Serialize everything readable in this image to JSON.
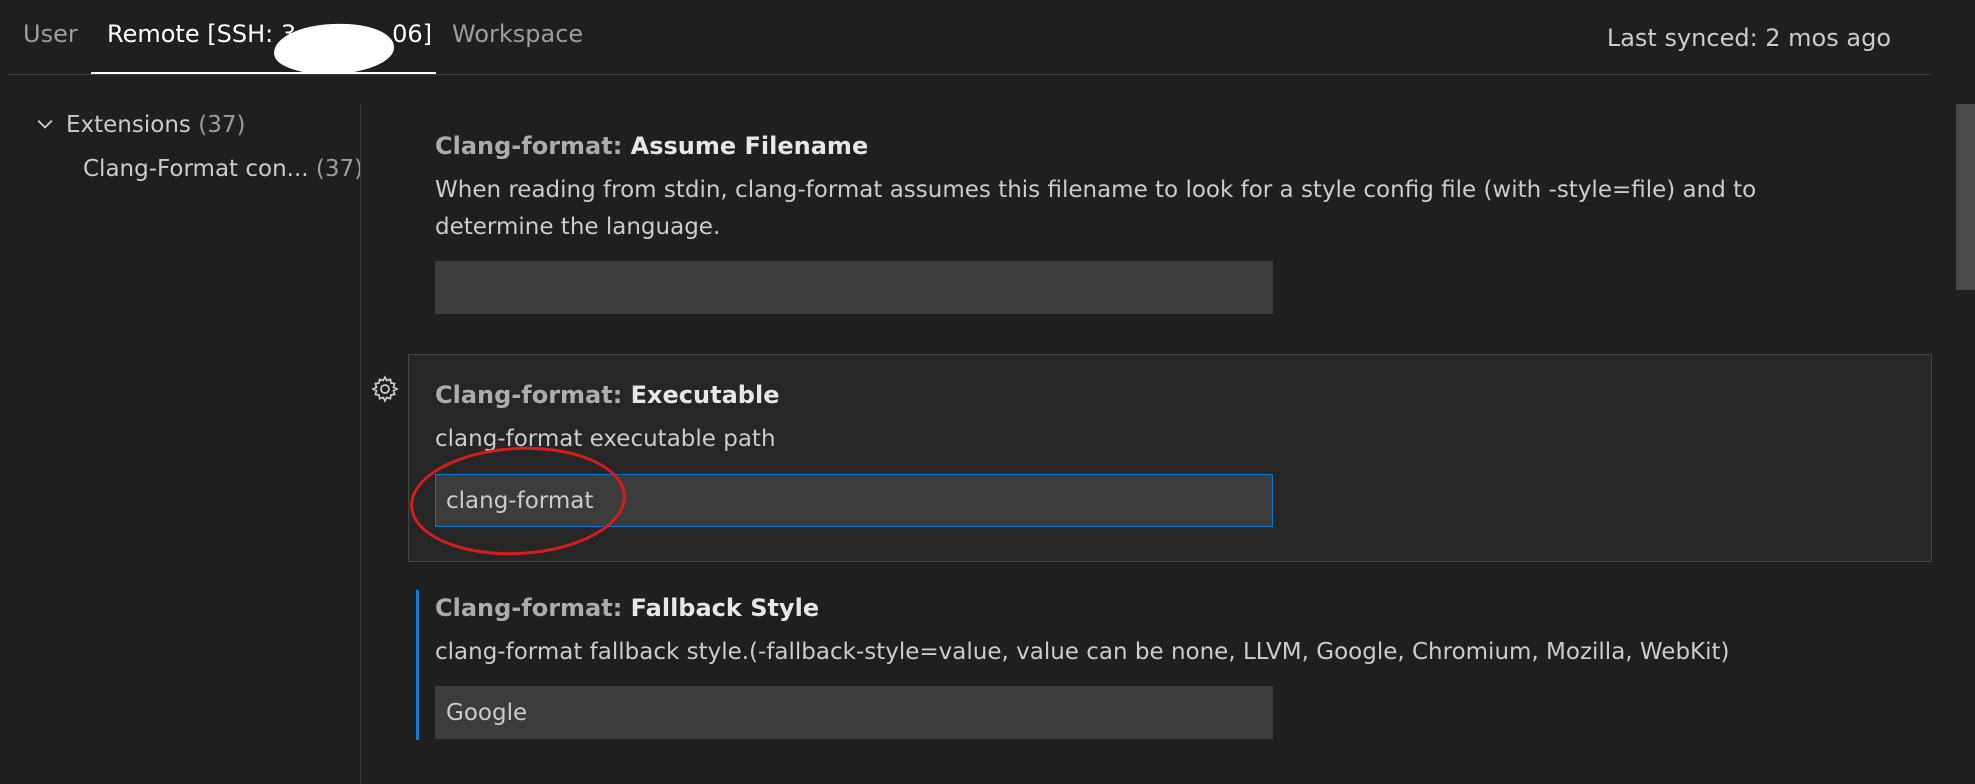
{
  "tabs": {
    "user": "User",
    "remote": "Remote [SSH: 3",
    "remote_suffix": "06]",
    "workspace": "Workspace"
  },
  "last_synced": "Last synced: 2 mos ago",
  "toc": {
    "group_label": "Extensions",
    "group_count": "(37)",
    "item_label": "Clang-Format con...",
    "item_count": "(37)"
  },
  "settings": [
    {
      "category": "Clang-format: ",
      "name": "Assume Filename",
      "description": "When reading from stdin, clang-format assumes this filename to look for a style config file (with -style=file) and to determine the language.",
      "value": ""
    },
    {
      "category": "Clang-format: ",
      "name": "Executable",
      "description": "clang-format executable path",
      "value": "clang-format"
    },
    {
      "category": "Clang-format: ",
      "name": "Fallback Style",
      "description": "clang-format fallback style.(-fallback-style=value, value can be none, LLVM, Google, Chromium, Mozilla, WebKit)",
      "value": "Google"
    }
  ],
  "colors": {
    "background": "#1f1f1f",
    "focus_border": "#0078d4",
    "modified_indicator": "#0c7dd6",
    "annotation": "#d81c1c"
  },
  "icons": {
    "toc_chevron": "chevron-down-icon",
    "setting_gear": "gear-icon"
  }
}
